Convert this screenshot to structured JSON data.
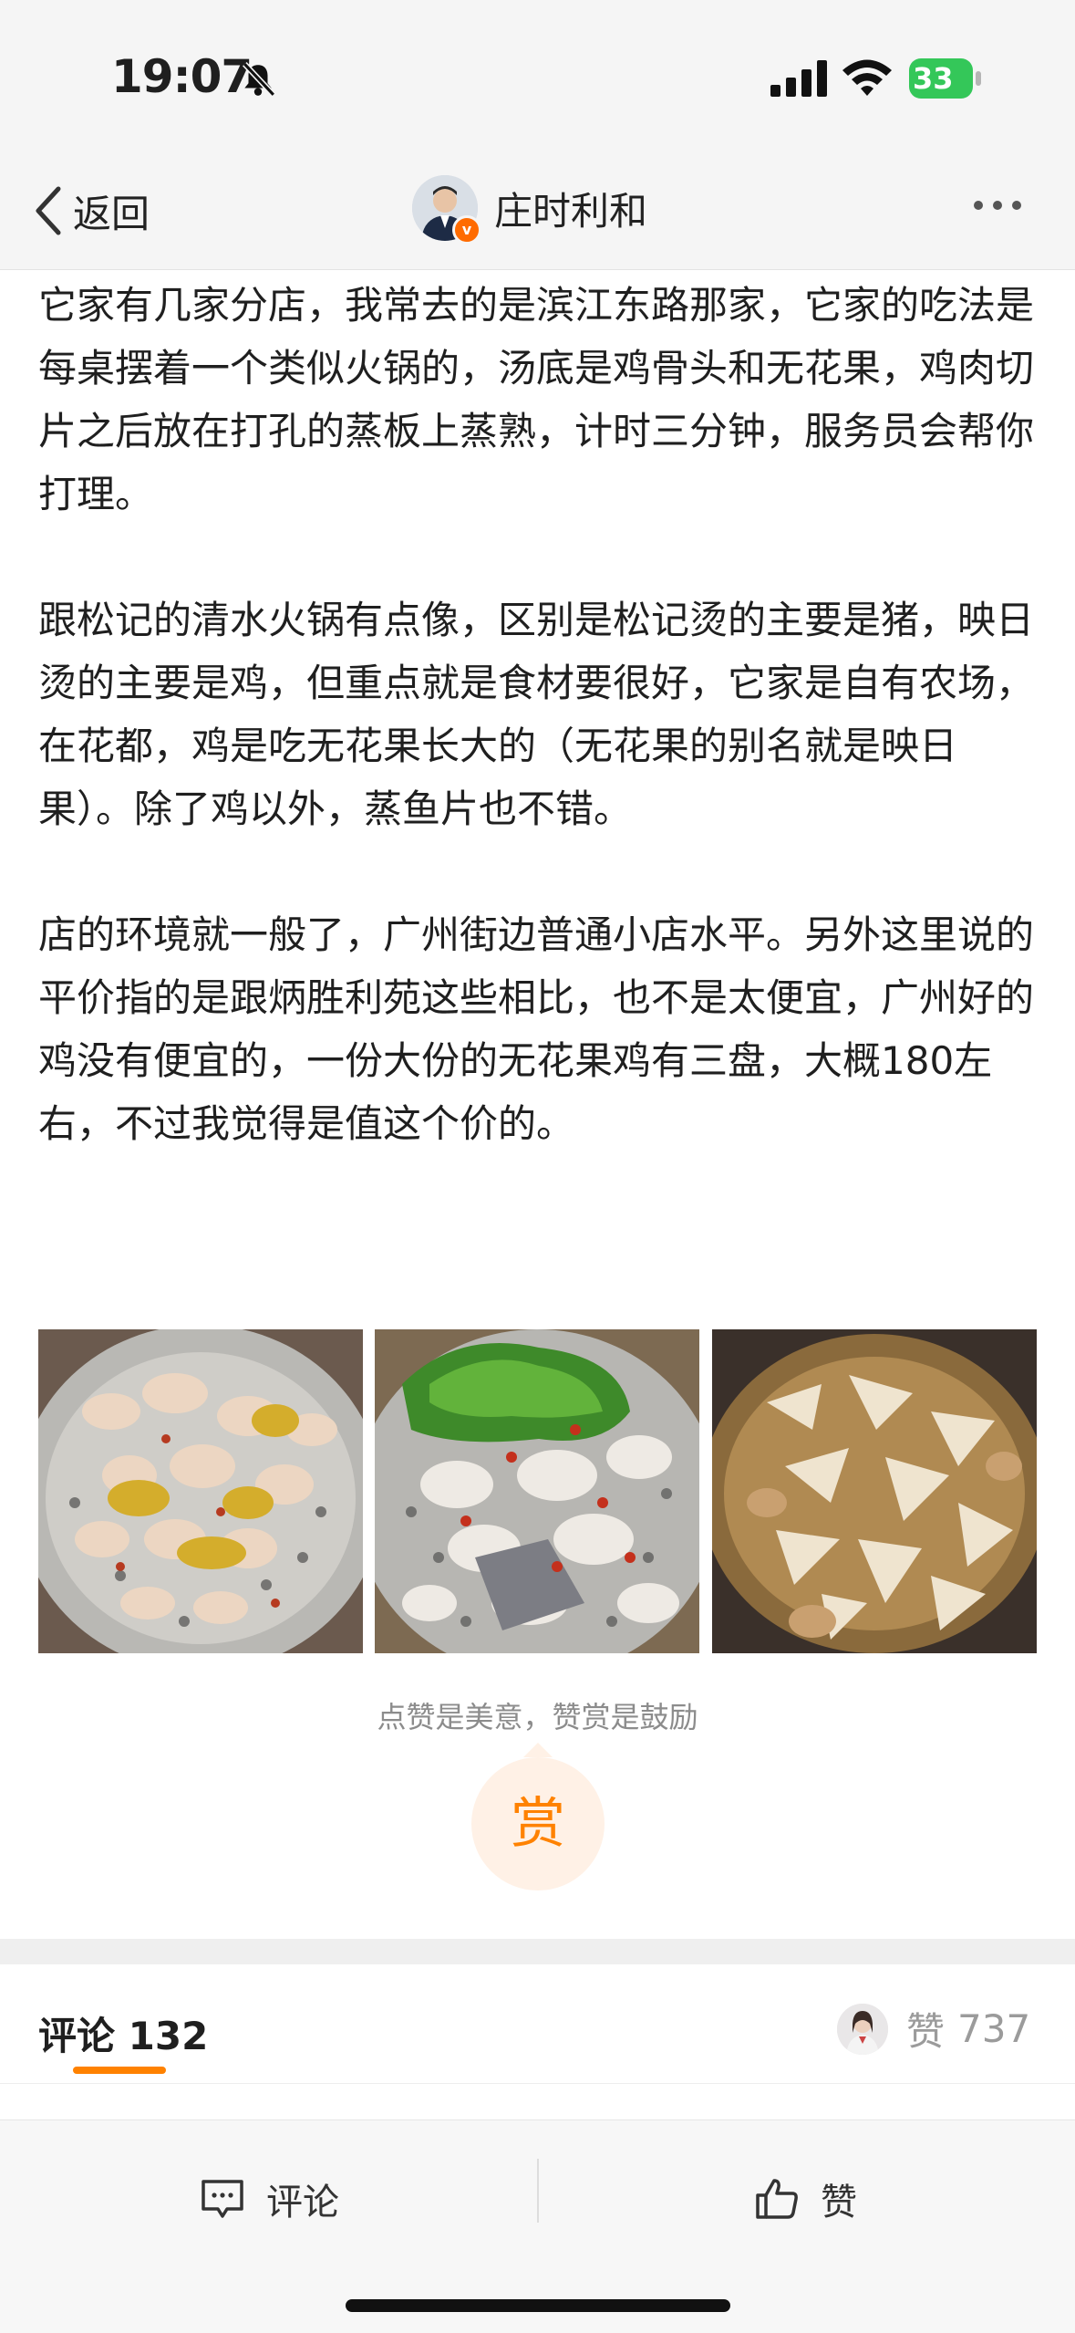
{
  "status_bar": {
    "time": "19:07",
    "battery": "33"
  },
  "nav": {
    "back_label": "返回",
    "author_name": "庄时利和"
  },
  "article": {
    "paragraphs": [
      "它家有几家分店，我常去的是滨江东路那家，它家的吃法是每桌摆着一个类似火锅的，汤底是鸡骨头和无花果，鸡肉切片之后放在打孔的蒸板上蒸熟，计时三分钟，服务员会帮你打理。",
      "跟松记的清水火锅有点像，区别是松记烫的主要是猪，映日烫的主要是鸡，但重点就是食材要很好，它家是自有农场，在花都，鸡是吃无花果长大的（无花果的别名就是映日果）。除了鸡以外，蒸鱼片也不错。",
      "店的环境就一般了，广州街边普通小店水平。另外这里说的平价指的是跟炳胜利苑这些相比，也不是太便宜，广州好的鸡没有便宜的，一份大份的无花果鸡有三盘，大概180左右，不过我觉得是值这个价的。"
    ]
  },
  "reward": {
    "tip": "点赞是美意，赞赏是鼓励",
    "button_label": "赏"
  },
  "comments": {
    "tab_label": "评论 132",
    "likes_label": "赞",
    "likes_count": "737"
  },
  "toolbar": {
    "comment_label": "评论",
    "like_label": "赞"
  },
  "colors": {
    "accent": "#ff8200",
    "reward_bg": "#fff1e6",
    "battery": "#34c759",
    "nav_bg": "#f5f5f5"
  }
}
